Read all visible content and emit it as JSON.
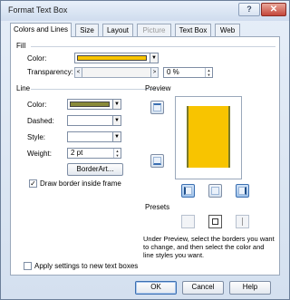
{
  "window": {
    "title": "Format Text Box",
    "help_glyph": "?",
    "close_glyph": "✕"
  },
  "tabs": [
    {
      "label": "Colors and Lines",
      "state": "active"
    },
    {
      "label": "Size",
      "state": "normal"
    },
    {
      "label": "Layout",
      "state": "normal"
    },
    {
      "label": "Picture",
      "state": "disabled"
    },
    {
      "label": "Text Box",
      "state": "normal"
    },
    {
      "label": "Web",
      "state": "normal"
    }
  ],
  "fill": {
    "section_label": "Fill",
    "color_label": "Color:",
    "color_value": "#f8c400",
    "transparency_label": "Transparency:",
    "transparency_value": "0 %",
    "slider_left": "<",
    "slider_right": ">"
  },
  "line": {
    "section_label": "Line",
    "color_label": "Color:",
    "color_value": "#8a8a3a",
    "dashed_label": "Dashed:",
    "style_label": "Style:",
    "weight_label": "Weight:",
    "weight_value": "2 pt",
    "borderart_label": "BorderArt...",
    "draw_inside_label": "Draw border inside frame",
    "draw_inside_checked": "✓"
  },
  "preview": {
    "section_label": "Preview",
    "presets_label": "Presets",
    "help_text": "Under Preview, select the borders you want to change, and then select the color and line styles you want."
  },
  "footer": {
    "apply_new_label": "Apply settings to new text boxes",
    "ok_label": "OK",
    "cancel_label": "Cancel",
    "help_label": "Help"
  },
  "glyphs": {
    "dropdown": "▼",
    "spin_up": "▲",
    "spin_down": "▼"
  },
  "colors": {
    "accent": "#3b6fb1"
  }
}
